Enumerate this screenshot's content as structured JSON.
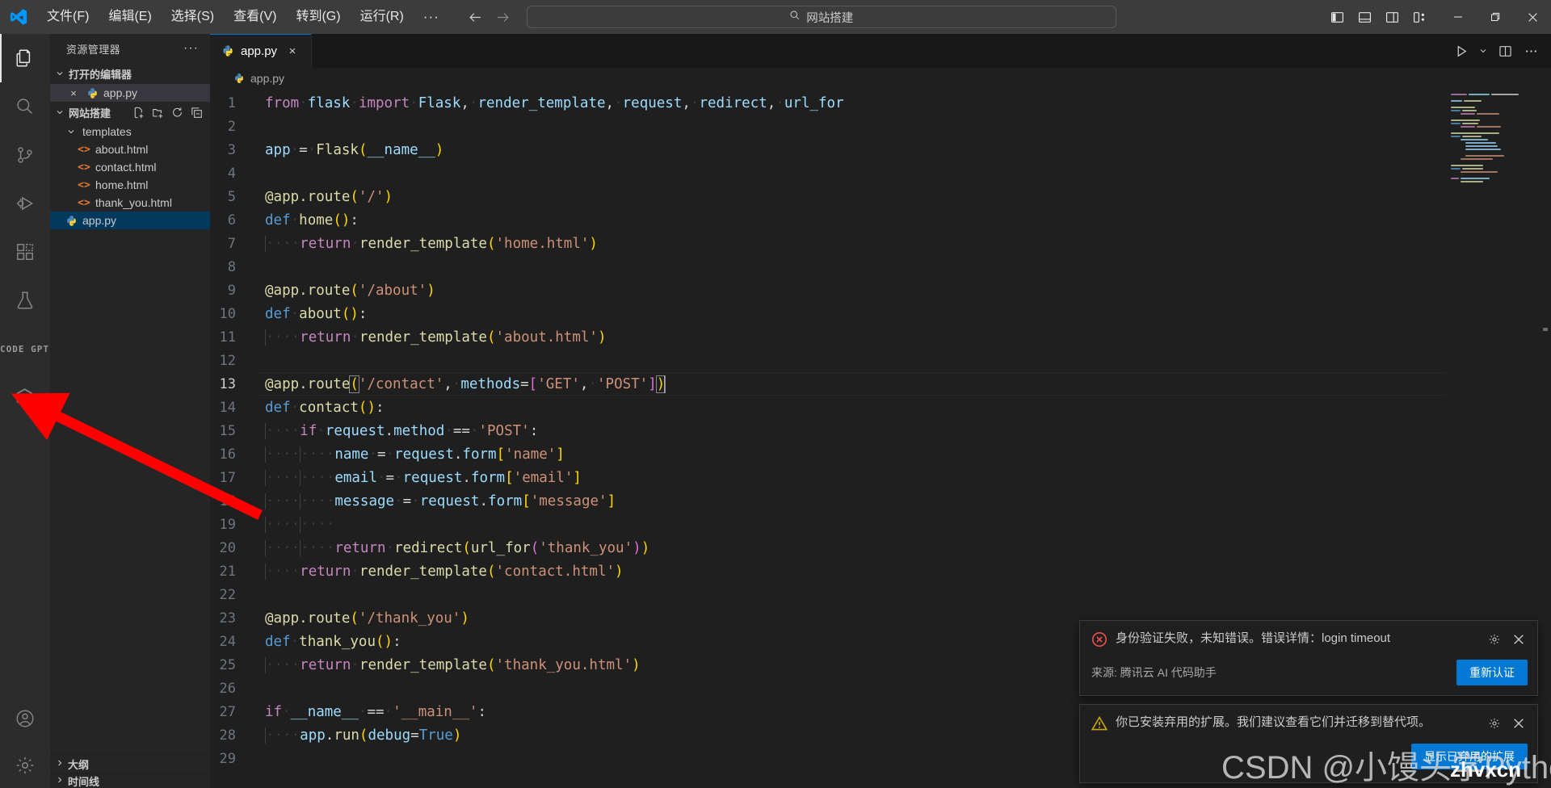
{
  "titlebar": {
    "logo": "vscode-logo",
    "menus": [
      {
        "label": "文件(F)",
        "name": "menu-file"
      },
      {
        "label": "编辑(E)",
        "name": "menu-edit"
      },
      {
        "label": "选择(S)",
        "name": "menu-selection"
      },
      {
        "label": "查看(V)",
        "name": "menu-view"
      },
      {
        "label": "转到(G)",
        "name": "menu-go"
      },
      {
        "label": "运行(R)",
        "name": "menu-run"
      }
    ],
    "more_label": "···",
    "command_center": {
      "text": "网站搭建",
      "icon": "search-icon"
    },
    "layout_buttons": [
      {
        "name": "toggle-primary-sidebar-icon"
      },
      {
        "name": "toggle-panel-icon"
      },
      {
        "name": "toggle-secondary-sidebar-icon"
      },
      {
        "name": "customize-layout-icon"
      }
    ],
    "window_controls": {
      "minimize": "minimize-icon",
      "maximize": "maximize-icon",
      "close": "close-icon"
    }
  },
  "activitybar": {
    "items": [
      {
        "name": "activity-explorer",
        "icon": "files-icon",
        "active": true
      },
      {
        "name": "activity-search",
        "icon": "search-icon",
        "active": false
      },
      {
        "name": "activity-source-control",
        "icon": "source-control-icon",
        "active": false
      },
      {
        "name": "activity-run-debug",
        "icon": "debug-alt-icon",
        "active": false
      },
      {
        "name": "activity-extensions",
        "icon": "extensions-icon",
        "active": false
      },
      {
        "name": "activity-testing",
        "icon": "beaker-icon",
        "active": false
      },
      {
        "name": "activity-codegpt",
        "icon": "codegpt-icon",
        "label": "CODE GPT",
        "active": false
      },
      {
        "name": "activity-tencent-cloud-ai",
        "icon": "hexagon-icon",
        "active": false
      }
    ],
    "bottom": [
      {
        "name": "account-icon"
      },
      {
        "name": "settings-gear-icon"
      }
    ]
  },
  "sidebar": {
    "title": "资源管理器",
    "more_actions": "···",
    "open_editors": {
      "label": "打开的编辑器",
      "items": [
        {
          "name": "app.py",
          "icon": "python-icon",
          "close": "×"
        }
      ]
    },
    "workspace": {
      "label": "网站搭建",
      "actions": [
        {
          "name": "new-file-icon"
        },
        {
          "name": "new-folder-icon"
        },
        {
          "name": "refresh-icon"
        },
        {
          "name": "collapse-all-icon"
        }
      ],
      "tree": [
        {
          "label": "templates",
          "type": "folder",
          "expanded": true,
          "depth": 1
        },
        {
          "label": "about.html",
          "type": "html",
          "depth": 2
        },
        {
          "label": "contact.html",
          "type": "html",
          "depth": 2
        },
        {
          "label": "home.html",
          "type": "html",
          "depth": 2
        },
        {
          "label": "thank_you.html",
          "type": "html",
          "depth": 2
        },
        {
          "label": "app.py",
          "type": "python",
          "depth": 1,
          "selected": true
        }
      ]
    },
    "collapsed_sections": [
      {
        "label": "大纲"
      },
      {
        "label": "时间线"
      }
    ]
  },
  "editor": {
    "tab": {
      "label": "app.py",
      "icon": "python-icon",
      "close": "×"
    },
    "tab_actions": [
      {
        "name": "run-python-file-icon"
      },
      {
        "name": "run-dropdown-chevron-icon"
      },
      {
        "name": "split-editor-icon"
      },
      {
        "name": "more-actions-icon"
      }
    ],
    "breadcrumb": {
      "icon": "python-icon",
      "text": "app.py"
    },
    "language": "python",
    "active_line": 13,
    "code_lines": [
      {
        "n": 1,
        "text": "from flask import Flask, render_template, request, redirect, url_for"
      },
      {
        "n": 2,
        "text": ""
      },
      {
        "n": 3,
        "text": "app = Flask(__name__)"
      },
      {
        "n": 4,
        "text": ""
      },
      {
        "n": 5,
        "text": "@app.route('/')"
      },
      {
        "n": 6,
        "text": "def home():"
      },
      {
        "n": 7,
        "text": "    return render_template('home.html')"
      },
      {
        "n": 8,
        "text": ""
      },
      {
        "n": 9,
        "text": "@app.route('/about')"
      },
      {
        "n": 10,
        "text": "def about():"
      },
      {
        "n": 11,
        "text": "    return render_template('about.html')"
      },
      {
        "n": 12,
        "text": ""
      },
      {
        "n": 13,
        "text": "@app.route('/contact', methods=['GET', 'POST'])"
      },
      {
        "n": 14,
        "text": "def contact():"
      },
      {
        "n": 15,
        "text": "    if request.method == 'POST':"
      },
      {
        "n": 16,
        "text": "        name = request.form['name']"
      },
      {
        "n": 17,
        "text": "        email = request.form['email']"
      },
      {
        "n": 18,
        "text": "        message = request.form['message']"
      },
      {
        "n": 19,
        "text": "        "
      },
      {
        "n": 20,
        "text": "        return redirect(url_for('thank_you'))"
      },
      {
        "n": 21,
        "text": "    return render_template('contact.html')"
      },
      {
        "n": 22,
        "text": ""
      },
      {
        "n": 23,
        "text": "@app.route('/thank_you')"
      },
      {
        "n": 24,
        "text": "def thank_you():"
      },
      {
        "n": 25,
        "text": "    return render_template('thank_you.html')"
      },
      {
        "n": 26,
        "text": ""
      },
      {
        "n": 27,
        "text": "if __name__ == '__main__':"
      },
      {
        "n": 28,
        "text": "    app.run(debug=True)"
      },
      {
        "n": 29,
        "text": ""
      }
    ]
  },
  "notifications": [
    {
      "severity": "error",
      "icon": "error-circle-icon",
      "message": "身份验证失败，未知错误。错误详情：login timeout",
      "source": "来源: 腾讯云 AI 代码助手",
      "button": "重新认证",
      "tools": [
        {
          "name": "notification-settings-gear-icon"
        },
        {
          "name": "notification-close-icon"
        }
      ]
    },
    {
      "severity": "warning",
      "icon": "warning-triangle-icon",
      "message": "你已安装弃用的扩展。我们建议查看它们并迁移到替代项。",
      "button": "显示已弃用的扩展",
      "tools": [
        {
          "name": "notification-settings-gear-icon"
        },
        {
          "name": "notification-close-icon"
        }
      ]
    }
  ],
  "overlays": {
    "watermark": "CSDN @小馒头学Python",
    "watermark2": "zhvxcn",
    "annotation_arrow": {
      "name": "red-arrow-annotation",
      "color": "#ff0000",
      "points_to": "activity-tencent-cloud-ai"
    }
  },
  "colors": {
    "accent": "#0078d4",
    "error": "#f14c4c",
    "warning": "#cca700",
    "titlebar_bg": "#3c3c3c",
    "sidebar_bg": "#252526",
    "editor_bg": "#1f1f1f",
    "activitybar_bg": "#2c2c2c"
  }
}
